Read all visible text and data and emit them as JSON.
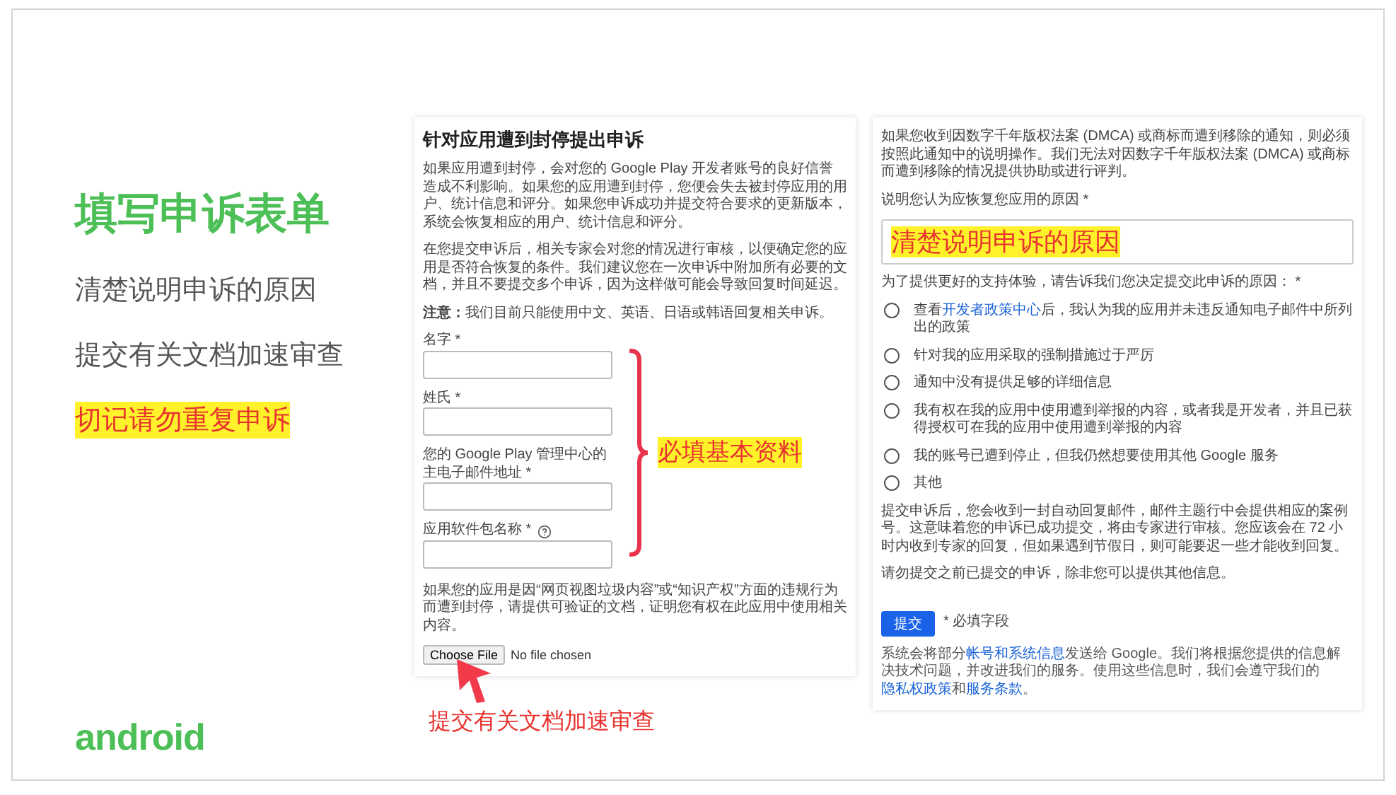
{
  "slide": {
    "title": "填写申诉表单",
    "points": [
      {
        "text": "清楚说明申诉的原因",
        "kind": "plain"
      },
      {
        "text": "提交有关文档加速审查",
        "kind": "plain"
      },
      {
        "text": "切记请勿重复申诉",
        "kind": "highlight"
      }
    ],
    "logo": "android"
  },
  "left_form": {
    "title": "针对应用遭到封停提出申诉",
    "paragraphs": [
      "如果应用遭到封停，会对您的 Google Play 开发者账号的良好信誉造成不利影响。如果您的应用遭到封停，您便会失去被封停应用的用户、统计信息和评分。如果您申诉成功并提交符合要求的更新版本，系统会恢复相应的用户、统计信息和评分。",
      "在您提交申诉后，相关专家会对您的情况进行审核，以便确定您的应用是否符合恢复的条件。我们建议您在一次申诉中附加所有必要的文档，并且不要提交多个申诉，因为这样做可能会导致回复时间延迟。",
      "**注意：**我们目前只能使用中文、英语、日语或韩语回复相关申诉。"
    ],
    "fields": [
      {
        "label": "名字 *",
        "help": false
      },
      {
        "label": "姓氏 *",
        "help": false
      },
      {
        "label": "您的 Google Play 管理中心的主电子邮件地址 *",
        "help": false
      },
      {
        "label": "应用软件包名称 *",
        "help": true
      }
    ],
    "fields_annotation": "必填基本资料",
    "docs_text": "如果您的应用是因“网页视图垃圾内容”或“知识产权”方面的违规行为而遭到封停，请提供可验证的文档，证明您有权在此应用中使用相关内容。",
    "file_button": "Choose File",
    "file_status": "No file chosen",
    "docs_annotation": "提交有关文档加速审查"
  },
  "right_form": {
    "intro": "如果您收到因数字千年版权法案 (DMCA) 或商标而遭到移除的通知，则必须按照此通知中的说明操作。我们无法对因数字千年版权法案 (DMCA) 或商标而遭到移除的情况提供协助或进行评判。",
    "reason_label": "说明您认为应恢复您应用的原因 *",
    "reason_value": "清楚说明申诉的原因",
    "question": "为了提供更好的支持体验，请告诉我们您决定提交此申诉的原因： *",
    "options": [
      {
        "parts": [
          {
            "text": "查看",
            "link": false
          },
          {
            "text": "开发者政策中心",
            "link": true
          },
          {
            "text": "后，我认为我的应用并未违反通知电子邮件中所列出的政策",
            "link": false
          }
        ],
        "selected": false
      },
      {
        "parts": [
          {
            "text": "针对我的应用采取的强制措施过于严厉",
            "link": false
          }
        ],
        "selected": false
      },
      {
        "parts": [
          {
            "text": "通知中没有提供足够的详细信息",
            "link": false
          }
        ],
        "selected": false
      },
      {
        "parts": [
          {
            "text": "我有权在我的应用中使用遭到举报的内容，或者我是开发者，并且已获得授权可在我的应用中使用遭到举报的内容",
            "link": false
          }
        ],
        "selected": false
      },
      {
        "parts": [
          {
            "text": "我的账号已遭到停止，但我仍然想要使用其他 Google 服务",
            "link": false
          }
        ],
        "selected": false
      },
      {
        "parts": [
          {
            "text": "其他",
            "link": false
          }
        ],
        "selected": false
      }
    ],
    "paragraphs": [
      "提交申诉后，您会收到一封自动回复邮件，邮件主题行中会提供相应的案例号。这意味着您的申诉已成功提交，将由专家进行审核。您应该会在 72 小时内收到专家的回复，但如果遇到节假日，则可能要迟一些才能收到回复。",
      "请勿提交之前已提交的申诉，除非您可以提供其他信息。"
    ],
    "submit": "提交",
    "required_note": "* 必填字段",
    "footer": [
      {
        "text": "系统会将部分",
        "link": false
      },
      {
        "text": "帐号和系统信息",
        "link": true
      },
      {
        "text": "发送给 Google。我们将根据您提供的信息解决技术问题，并改进我们的服务。使用这些信息时，我们会遵守我们的",
        "link": false
      },
      {
        "text": "隐私权政策",
        "link": true
      },
      {
        "text": "和",
        "link": false
      },
      {
        "text": "服务条款",
        "link": true
      },
      {
        "text": "。",
        "link": false
      }
    ]
  }
}
